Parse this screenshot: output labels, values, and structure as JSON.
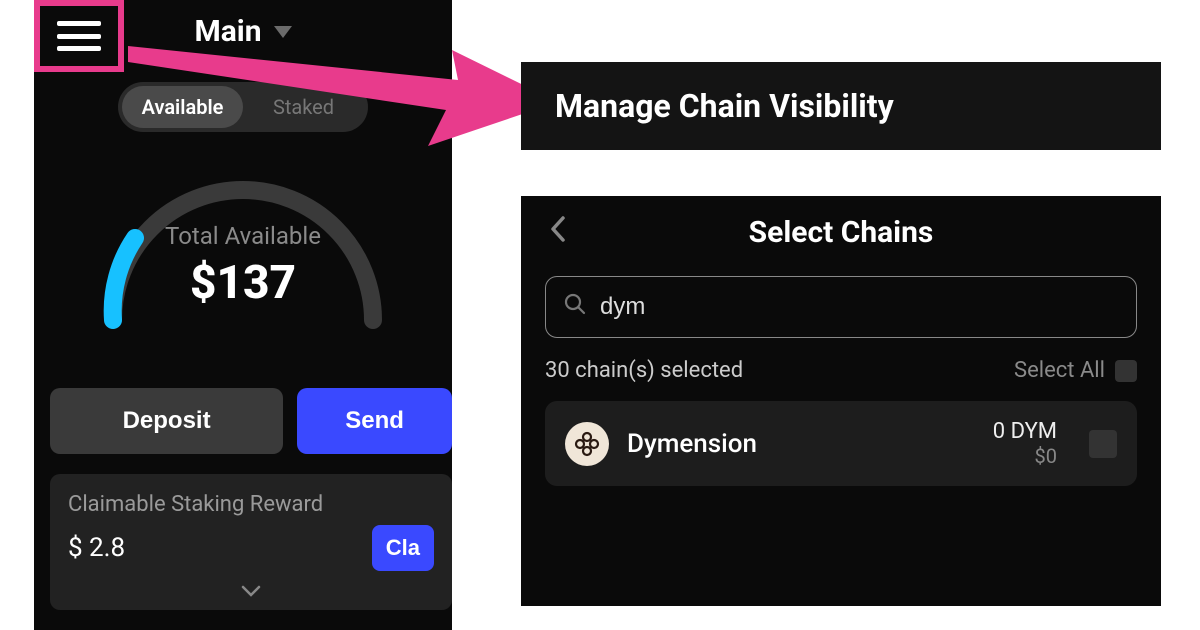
{
  "colors": {
    "accent_pink": "#e83b8c",
    "accent_blue": "#3a49ff",
    "gauge_cyan": "#17c1ff",
    "gauge_track": "#3a3a3a"
  },
  "left": {
    "title": "Main",
    "tabs": {
      "available": "Available",
      "staked": "Staked"
    },
    "total_label": "Total Available",
    "total_value": "$137",
    "deposit": "Deposit",
    "send": "Send",
    "reward_label": "Claimable Staking Reward",
    "reward_amount": "$ 2.8",
    "claim": "Cla"
  },
  "right_top": {
    "title": "Manage Chain Visibility"
  },
  "right_bottom": {
    "title": "Select Chains",
    "search_value": "dym",
    "selected_count": "30 chain(s) selected",
    "select_all": "Select All",
    "chain": {
      "name": "Dymension",
      "amount": "0 DYM",
      "usd": "$0"
    }
  }
}
